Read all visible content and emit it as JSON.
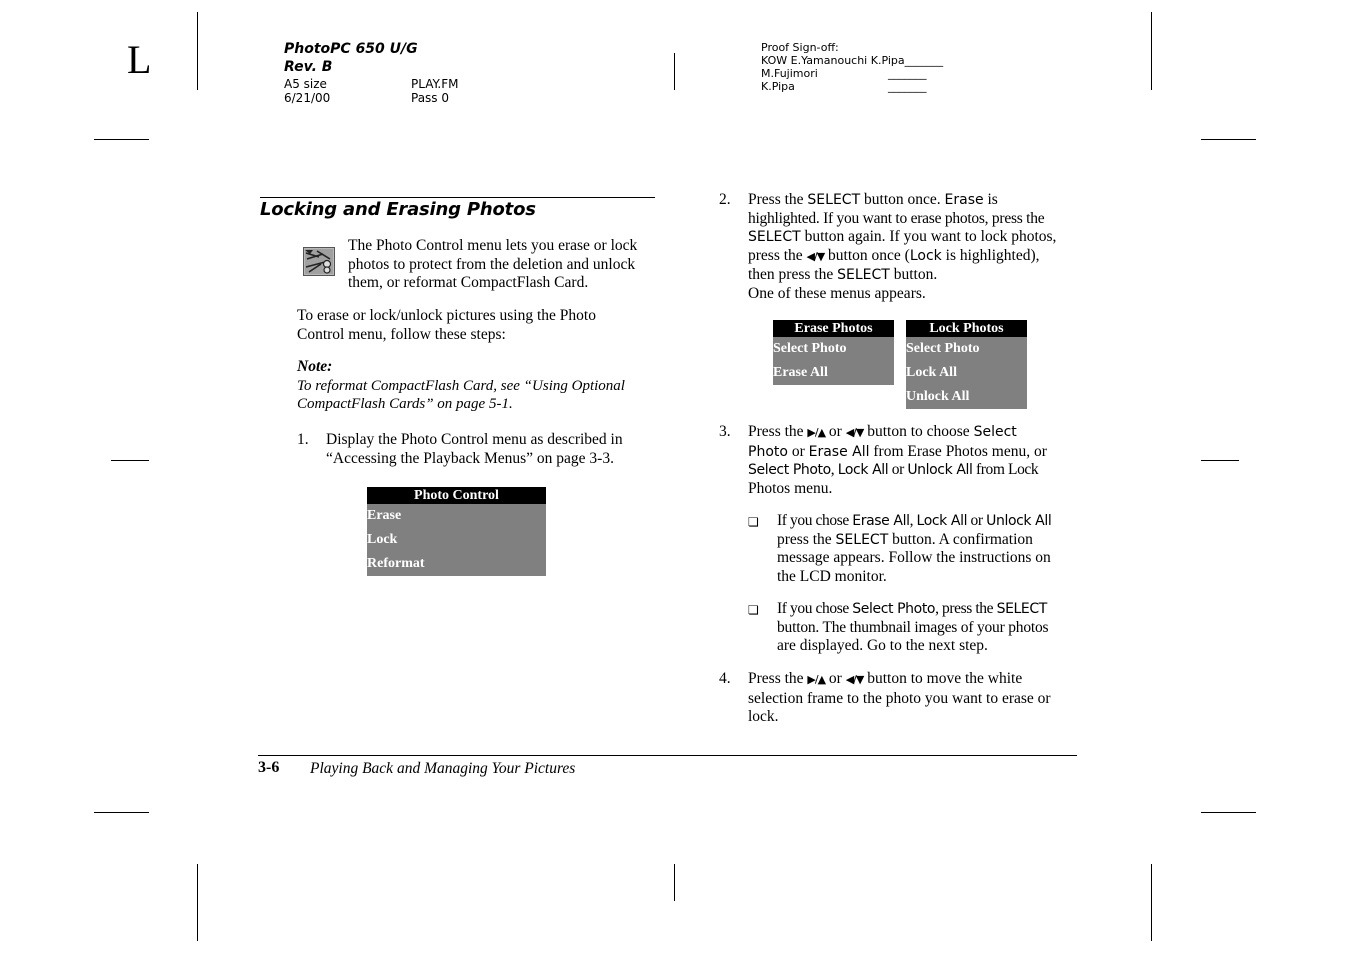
{
  "header": {
    "corner_letter": "L",
    "product": "PhotoPC 650 U/G",
    "revision": "Rev. B",
    "size": "A5 size",
    "date": "6/21/00",
    "file": "PLAY.FM",
    "pass": "Pass 0",
    "proof": {
      "title": "Proof Sign-off:",
      "line1": "KOW E.Yamanouchi  K.Pipa_______",
      "line2_name": "M.Fujimori",
      "line2_blank": "_______",
      "line3_name": "K.Pipa",
      "line3_blank": "_______"
    }
  },
  "section": {
    "title": "Locking and Erasing Photos",
    "intro_icon": "photo-control-icon",
    "intro": [
      "The Photo Control menu lets you erase or lock",
      "photos to protect from the deletion and unlock",
      "them, or reformat CompactFlash Card."
    ],
    "lead": [
      "To erase or lock/unlock pictures using the Photo",
      "Control menu, follow these steps:"
    ],
    "note_label": "Note:",
    "note": [
      "To reformat CompactFlash Card, see “Using Optional",
      "CompactFlash Cards” on page 5-1."
    ]
  },
  "steps": [
    {
      "number": "1.",
      "lines": [
        "Display the Photo Control menu as described in",
        "“Accessing the Playback Menus” on page 3-3."
      ]
    },
    {
      "number": "2.",
      "l1a": "Press the ",
      "l1b": "SELECT",
      "l1c": " button once. ",
      "l1d": "Erase",
      "l1e": " is",
      "l2": "highlighted. If you want to erase photos, press the",
      "l3a": "SELECT",
      "l3b": " button again. If you want to lock photos,",
      "l4a": "press the ",
      "l4btn": "◀/▼",
      "l4b": " button once (",
      "l4c": "Lock",
      "l4d": " is highlighted),",
      "l5a": "then press the ",
      "l5b": "SELECT",
      "l5c": " button.",
      "l6": "One of these menus appears."
    },
    {
      "number": "3.",
      "l1a": "Press the ",
      "btn1": "▶/▲",
      "l1b": " or ",
      "btn2": "◀/▼",
      "l1c": " button to choose ",
      "l1d": "Select",
      "l2a": "Photo",
      "l2b": " or ",
      "l2c": "Erase All",
      "l2d": " from Erase Photos menu, or",
      "l3a": "Select Photo",
      "l3b": ", ",
      "l3c": "Lock All",
      "l3d": " or ",
      "l3e": "Unlock All",
      "l3f": " from Lock",
      "l4": "Photos menu.",
      "bullets": [
        {
          "symbol": "❏",
          "l1a": "If you chose ",
          "l1b": "Erase All",
          "l1c": ", ",
          "l1d": "Lock All",
          "l1e": " or ",
          "l1f": "Unlock All",
          "l2a": "press the ",
          "l2b": "SELECT",
          "l2c": " button. A confirmation",
          "l3": "message appears. Follow the instructions on",
          "l4": "the LCD monitor."
        },
        {
          "symbol": "❏",
          "l1a": "If you chose ",
          "l1b": "Select Photo",
          "l1c": ", press the ",
          "l1d": "SELECT",
          "l2": "button. The thumbnail images of your photos",
          "l3": "are displayed. Go to the next step."
        }
      ]
    },
    {
      "number": "4.",
      "l1a": "Press the ",
      "btn1": "▶/▲",
      "l1b": " or ",
      "btn2": "◀/▼",
      "l1c": " button to move the white",
      "l2": "selection frame to the photo you want to erase or",
      "l3": "lock."
    }
  ],
  "menus": {
    "photo_control": {
      "title": "Photo Control",
      "items": [
        "Erase",
        "Lock",
        "Reformat"
      ]
    },
    "erase_photos": {
      "title": "Erase Photos",
      "items": [
        "Select Photo",
        "Erase All"
      ]
    },
    "lock_photos": {
      "title": "Lock Photos",
      "items": [
        "Select Photo",
        "Lock All",
        "Unlock All"
      ]
    }
  },
  "footer": {
    "page_number": "3-6",
    "chapter_title": "Playing Back and Managing Your Pictures"
  },
  "colors": {
    "lcd_title_bg": "#000000",
    "lcd_item_bg": "#808080",
    "lcd_text": "#ffffff"
  }
}
